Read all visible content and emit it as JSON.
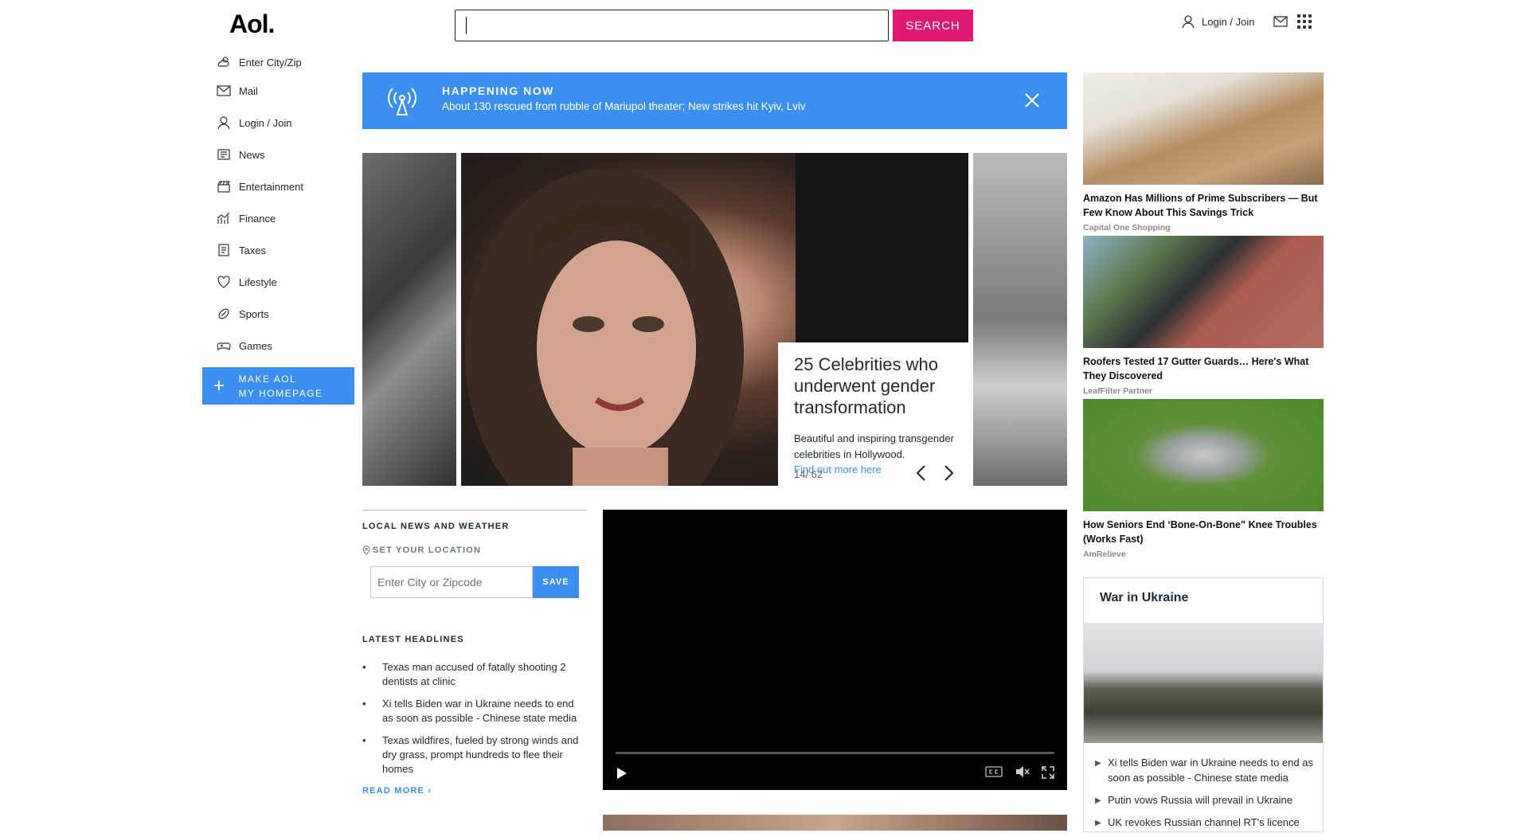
{
  "header": {
    "logo": "Aol.",
    "search_placeholder": "",
    "search_button": "SEARCH",
    "login": "Login / Join"
  },
  "sidebar": {
    "items": [
      {
        "label": "Enter City/Zip",
        "icon": "weather-icon"
      },
      {
        "label": "Mail",
        "icon": "mail-icon"
      },
      {
        "label": "Login / Join",
        "icon": "user-icon"
      },
      {
        "label": "News",
        "icon": "news-icon"
      },
      {
        "label": "Entertainment",
        "icon": "clapperboard-icon"
      },
      {
        "label": "Finance",
        "icon": "chart-icon"
      },
      {
        "label": "Taxes",
        "icon": "document-icon"
      },
      {
        "label": "Lifestyle",
        "icon": "heart-icon"
      },
      {
        "label": "Sports",
        "icon": "football-icon"
      },
      {
        "label": "Games",
        "icon": "gamepad-icon"
      }
    ],
    "make_home_line1": "MAKE AOL",
    "make_home_line2": "MY HOMEPAGE"
  },
  "banner": {
    "kicker": "HAPPENING NOW",
    "text": "About 130 rescued from rubble of Mariupol theater; New strikes hit Kyiv, Lviv"
  },
  "carousel": {
    "title": "25 Celebrities who underwent gender transformation",
    "description": "Beautiful and inspiring transgender celebrities in Hollywood.",
    "link": "Find out more here",
    "counter": "14/ 62"
  },
  "local": {
    "title": "LOCAL NEWS AND WEATHER",
    "set_location": "SET YOUR LOCATION",
    "zip_placeholder": "Enter City or Zipcode",
    "save": "SAVE",
    "latest_title": "LATEST HEADLINES",
    "headlines": [
      "Texas man accused of fatally shooting 2 dentists at clinic",
      "Xi tells Biden war in Ukraine needs to end as soon as possible - Chinese state media",
      "Texas wildfires, fueled by strong winds and dry grass, prompt hundreds to flee their homes"
    ],
    "read_more": "READ MORE ›"
  },
  "ads": [
    {
      "title": "Amazon Has Millions of Prime Subscribers — But Few Know About This Savings Trick",
      "source": "Capital One Shopping"
    },
    {
      "title": "Roofers Tested 17 Gutter Guards… Here's What They Discovered",
      "source": "LeafFilter Partner"
    },
    {
      "title": "How Seniors End ‘Bone-On-Bone” Knee Troubles (Works Fast)",
      "source": "AmRelieve"
    }
  ],
  "ukraine": {
    "title": "War in Ukraine",
    "items": [
      "Xi tells Biden war in Ukraine needs to end as soon as possible - Chinese state media",
      "Putin vows Russia will prevail in Ukraine",
      "UK revokes Russian channel RT's licence"
    ]
  },
  "colors": {
    "accent": "#3a8ff0",
    "search": "#e01a74"
  }
}
